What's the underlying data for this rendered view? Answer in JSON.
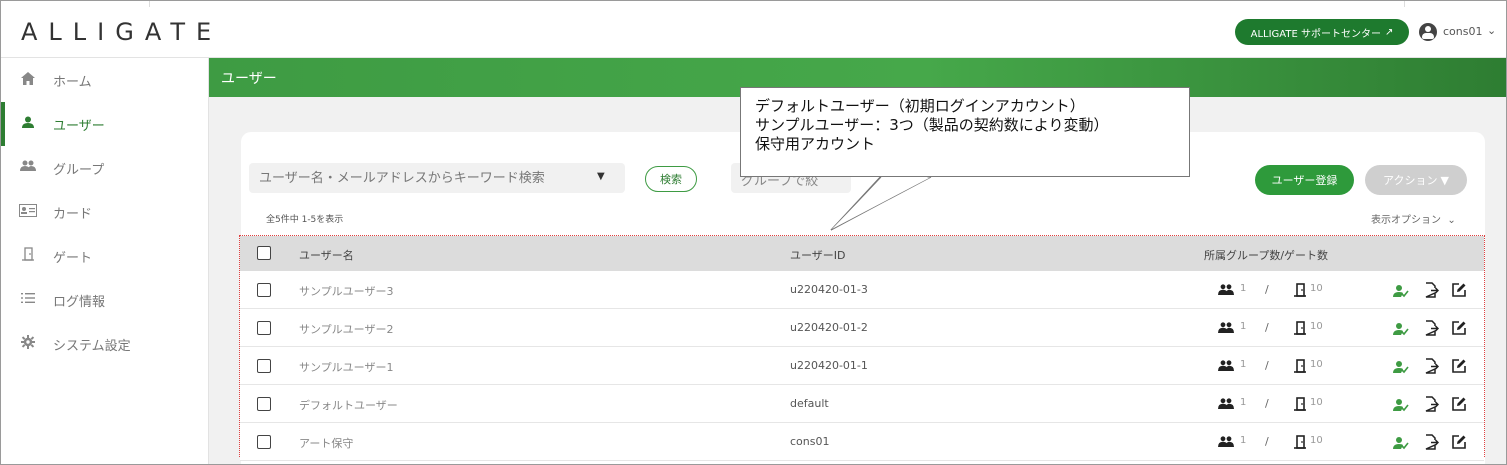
{
  "app": {
    "logo": "ALLIGATE",
    "support_label": "ALLIGATE サポートセンター",
    "username": "cons01"
  },
  "sidebar": {
    "items": [
      {
        "label": "ホーム",
        "icon": "home-icon"
      },
      {
        "label": "ユーザー",
        "icon": "user-icon",
        "active": true
      },
      {
        "label": "グループ",
        "icon": "group-icon"
      },
      {
        "label": "カード",
        "icon": "card-icon"
      },
      {
        "label": "ゲート",
        "icon": "gate-icon"
      },
      {
        "label": "ログ情報",
        "icon": "list-icon"
      },
      {
        "label": "システム設定",
        "icon": "gear-icon"
      }
    ]
  },
  "page": {
    "title": "ユーザー"
  },
  "toolbar": {
    "search_placeholder": "ユーザー名・メールアドレスからキーワード検索",
    "search_button": "検索",
    "group_filter": "グループで絞",
    "register_button": "ユーザー登録",
    "action_button": "アクション",
    "count_text": "全5件中 1-5を表示",
    "view_options": "表示オプション"
  },
  "table": {
    "headers": {
      "name": "ユーザー名",
      "uid": "ユーザーID",
      "groups": "所属グループ数/ゲート数"
    },
    "rows": [
      {
        "name": "サンプルユーザー3",
        "uid": "u220420-01-3",
        "groups": "1",
        "gates": "10"
      },
      {
        "name": "サンプルユーザー2",
        "uid": "u220420-01-2",
        "groups": "1",
        "gates": "10"
      },
      {
        "name": "サンプルユーザー1",
        "uid": "u220420-01-1",
        "groups": "1",
        "gates": "10"
      },
      {
        "name": "デフォルトユーザー",
        "uid": "default",
        "groups": "1",
        "gates": "10"
      },
      {
        "name": "アート保守",
        "uid": "cons01",
        "groups": "1",
        "gates": "10"
      }
    ]
  },
  "callout": {
    "lines": [
      "デフォルトユーザー（初期ログインアカウント）",
      "サンプルユーザー：3つ（製品の契約数により変動）",
      "保守用アカウント"
    ]
  },
  "colors": {
    "brand_green": "#2e7d32",
    "header_green": "#46a84a",
    "disabled_gray": "#cfcfcf"
  }
}
